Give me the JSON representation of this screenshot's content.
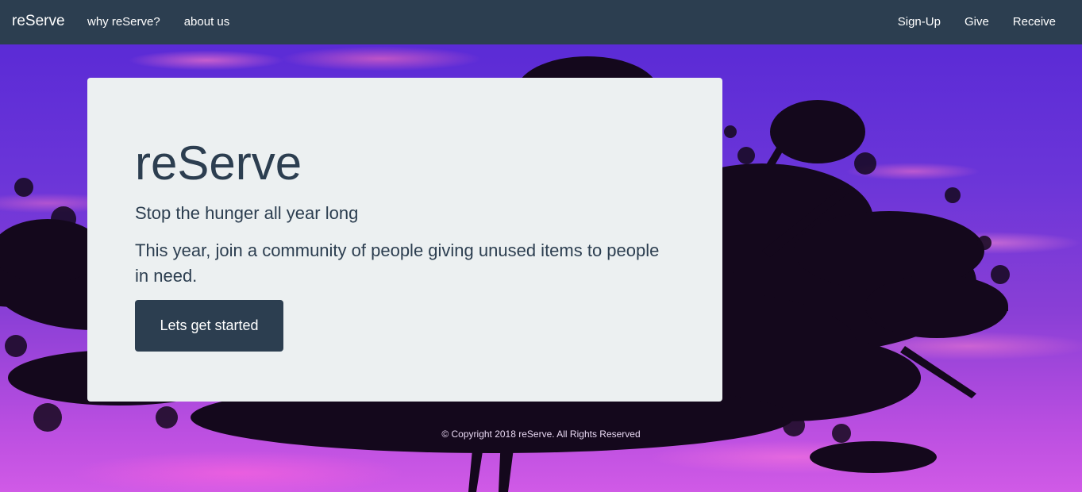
{
  "navbar": {
    "brand": "reServe",
    "left_links": [
      "why reServe?",
      "about us"
    ],
    "right_links": [
      "Sign-Up",
      "Give",
      "Receive"
    ]
  },
  "hero": {
    "title": "reServe",
    "tagline": "Stop the hunger all year long",
    "lead": "This year, join a community of people giving unused items to people in need.",
    "cta_label": "Lets get started"
  },
  "footer": {
    "copyright": "© Copyright 2018 reServe. All Rights Reserved"
  },
  "colors": {
    "navbar_bg": "#2c3e50",
    "card_bg": "#ecf0f1",
    "primary_text": "#2c3e50",
    "button_bg": "#2c3e50"
  }
}
